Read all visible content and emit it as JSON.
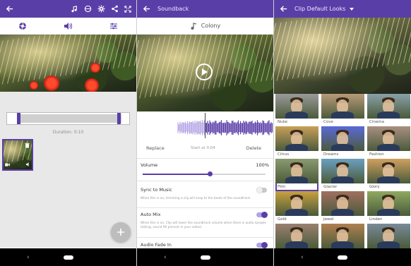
{
  "screen1": {
    "duration": "Duration: 0:10"
  },
  "screen2": {
    "appbar_title": "Soundback",
    "song_title": "Colony",
    "replace": "Replace",
    "start_at": "Start at 0:04",
    "delete": "Delete",
    "volume_label": "Volume",
    "volume_value": "100%",
    "volume_level": 0.55,
    "sync_label": "Sync to Music",
    "sync_desc": "When this is on, trimming a clip will snap to the beats of the soundtrack.",
    "sync_on": false,
    "automix_label": "Auto Mix",
    "automix_desc": "When this is on, Clip will lower the soundtrack volume when there is audio (people talking, sound 90 percent in your video).",
    "automix_on": true,
    "fadein_label": "Audio Fade In",
    "fadein_on": true
  },
  "screen3": {
    "appbar_title": "Clip Default Looks",
    "looks": [
      {
        "name": "Nuke",
        "tint": "#9a9a9a"
      },
      {
        "name": "Cove",
        "tint": "#b89a78"
      },
      {
        "name": "Cinema",
        "tint": "#8aa0a8"
      },
      {
        "name": "Citrus",
        "tint": "#c8a05a"
      },
      {
        "name": "Dreams",
        "tint": "#5a6ad8"
      },
      {
        "name": "Fashion",
        "tint": "#a89080"
      },
      {
        "name": "Film",
        "tint": "#8a9a70",
        "selected": true
      },
      {
        "name": "Glacier",
        "tint": "#6aa0c0"
      },
      {
        "name": "Glory",
        "tint": "#d0a060"
      },
      {
        "name": "Gold",
        "tint": "#c8a040"
      },
      {
        "name": "Jewel",
        "tint": "#a07060"
      },
      {
        "name": "Linden",
        "tint": "#90a860"
      },
      {
        "name": "",
        "tint": "#9a8070"
      },
      {
        "name": "",
        "tint": "#b08050"
      },
      {
        "name": "",
        "tint": "#7a8a9a"
      }
    ]
  },
  "colors": {
    "accent": "#5a3ea8",
    "appbar": "#5a3ea8"
  }
}
